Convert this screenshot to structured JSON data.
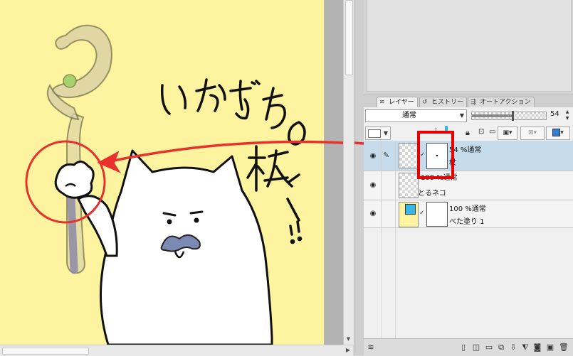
{
  "canvas": {
    "paper_color": "#fef39f",
    "annotation_color": "#e8312c",
    "handwriting_lines": [
      "いかずちの",
      "杖ー",
      "!!"
    ]
  },
  "layer_panel": {
    "tabs": [
      {
        "label": "レイヤー",
        "icon": "layers-icon"
      },
      {
        "label": "ヒストリー",
        "icon": "history-icon"
      },
      {
        "label": "オートアクション",
        "icon": "auto-action-icon"
      }
    ],
    "blend_mode": "通常",
    "opacity_value": "54",
    "opacity_fraction": 0.54,
    "layers": [
      {
        "mode": "54 %通常",
        "name": "杖",
        "selected": true
      },
      {
        "mode": "100 %通常",
        "name": "とるネコ",
        "selected": false
      },
      {
        "mode": "100 %通常",
        "name": "べた塗り 1",
        "selected": false
      }
    ]
  },
  "colors": {
    "selection": "#c6dcec",
    "highlight_box": "#e60000",
    "fill_layer_swatch": "#35b7e8"
  }
}
